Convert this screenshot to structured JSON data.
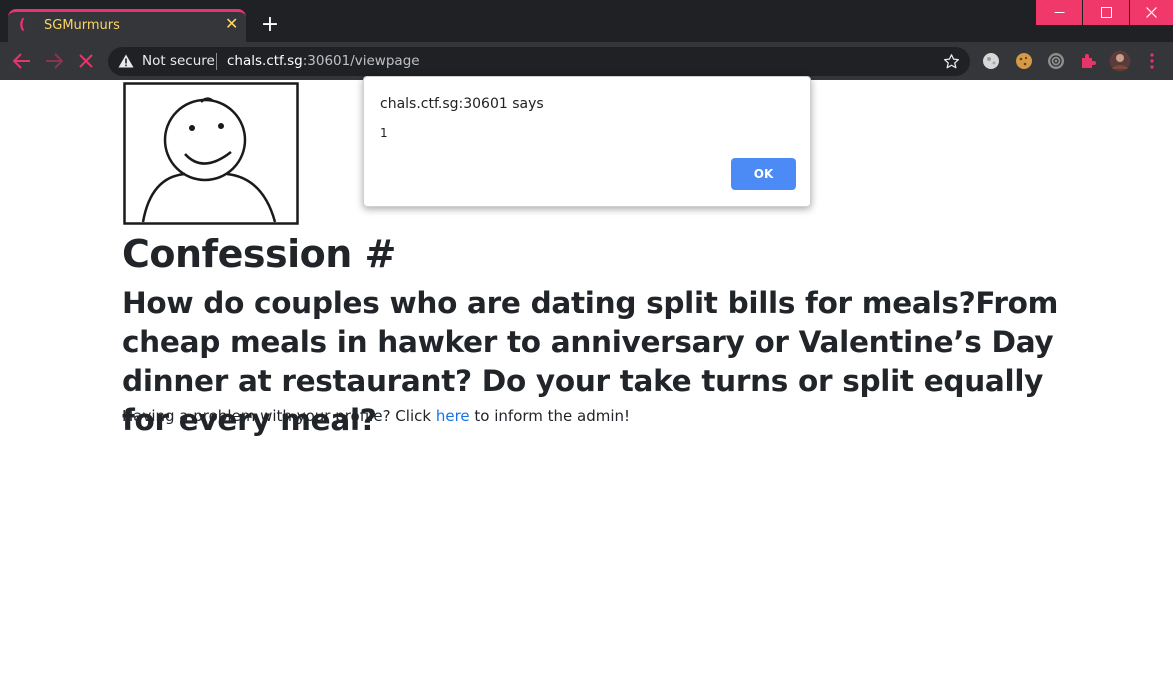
{
  "browser": {
    "tab": {
      "title": "SGMurmurs",
      "favicon": "loading-spinner-icon",
      "close": "✕"
    },
    "new_tab": "+",
    "address_bar": {
      "security_label": "Not secure",
      "url_host": "chals.ctf.sg",
      "url_rest": ":30601/viewpage"
    },
    "accent_color": "#e8336b",
    "window_controls_color": "#f0386b"
  },
  "page": {
    "title": "Confession #",
    "confession": "How do couples who are dating split bills for meals?From cheap meals in hawker to anniversary or Valentine’s Day dinner at restaurant? Do your take turns or split equally for every meal?",
    "help": {
      "before": "Having a problem with your profile? Click ",
      "link": "here",
      "after": " to inform the admin!"
    }
  },
  "dialog": {
    "title": "chals.ctf.sg:30601 says",
    "message": "1",
    "ok_label": "OK"
  }
}
